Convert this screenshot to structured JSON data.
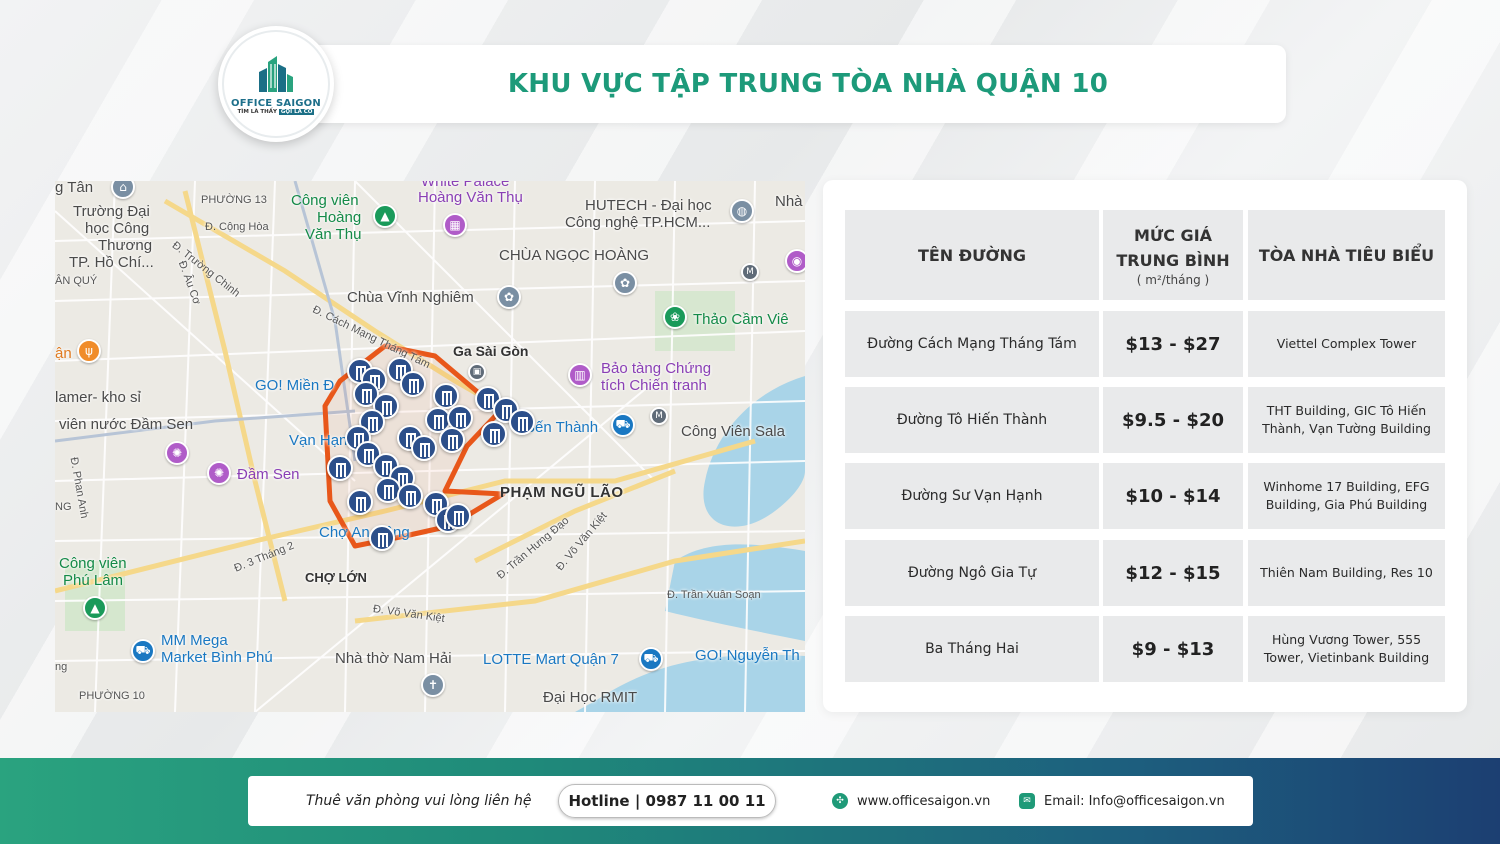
{
  "header": {
    "logo_brand": "OFFICE SAIGON",
    "logo_tagline_a": "TÌM LÀ THẤY",
    "logo_tagline_b": "GỌI LÀ CÓ",
    "title": "KHU VỰC TẬP TRUNG TÒA NHÀ QUẬN 10"
  },
  "map": {
    "labels": {
      "tan": "g Tân",
      "phuong13": "PHƯỜNG 13",
      "truong_dh": "Trường Đại",
      "hoc_cong": "học Công",
      "thuong": "Thương",
      "tphochi": "TP. Hồ Chí...",
      "an_quy": "ÂN QUÝ",
      "d_cong_hoa": "Đ. Cộng Hòa",
      "d_truong_chinh": "Đ. Trường Chinh",
      "d_au_co": "Đ. Âu Cơ",
      "cong_vien": "Công viên",
      "hoang": "Hoàng",
      "van_thu": "Văn Thụ",
      "white_palace": "White Palace",
      "hoang_van_thu": "Hoàng Văn Thụ",
      "hutech": "HUTECH - Đại học",
      "cong_nghe": "Công nghệ TP.HCM...",
      "nha": "Nhà",
      "chua_ngoc_hoang": "CHÙA NGỌC HOÀNG",
      "chua_vinh_nghiem": "Chùa Vĩnh Nghiêm",
      "thao_cam_vien": "Thảo Cầm Viê",
      "d_cmt8": "Đ. Cách Mạng Tháng Tám",
      "an": "ận",
      "ga_sai_gon": "Ga Sài Gòn",
      "go_mien_dong": "GO! Miền Đ",
      "bao_tang": "Bảo tàng Chứng",
      "tich_chien": "tích Chiến tranh",
      "hamer": "lamer- kho sỉ",
      "vien_nuoc": "viên nước Đầm Sen",
      "van_hanh": "Vạn Hạnh",
      "ben_thanh": "Bến Thành",
      "cong_vien_sala": "Công Viên Sala",
      "d_phan_anh": "Đ. Phan Anh",
      "dam_sen": "Đầm Sen",
      "pham_ngu_lao": "PHẠM NGŨ LÃO",
      "ng": "NG",
      "d_3_thang_2": "Đ. 3 Tháng 2",
      "cho_an_dong": "Chợ An Đông",
      "d_tran_hung_dao": "Đ. Trần Hưng Đạo",
      "d_vo_van_kiet": "Đ. Võ Văn Kiệt",
      "cong_vien_phu_lam_a": "Công viên",
      "cong_vien_phu_lam_b": "Phú Lâm",
      "cho_lon": "CHỢ LỚN",
      "d_vo_van_kiet2": "Đ. Võ Văn Kiệt",
      "d_tran_xuan_soan": "Đ. Trần Xuân Soạn",
      "mm_mega": "MM Mega",
      "market_binh_phu": "Market Bình Phú",
      "nha_tho_nam_hai": "Nhà thờ Nam Hải",
      "lotte_mart": "LOTTE Mart Quận 7",
      "go_nguyen": "GO! Nguyễn Th",
      "ng2": "ng",
      "phuong10": "PHƯỜNG 10",
      "dai_hoc_rmit": "Đại Học RMIT"
    },
    "accent_color": "#e8571a",
    "marker_color": "#2c4f8a",
    "marker_icon": "building-icon"
  },
  "table": {
    "headers": {
      "street": "TÊN ĐƯỜNG",
      "price_a": "MỨC GIÁ",
      "price_b": "TRUNG BÌNH",
      "price_unit": "( m²/tháng )",
      "buildings": "TÒA NHÀ TIÊU BIỂU"
    },
    "rows": [
      {
        "street": "Đường Cách Mạng Tháng Tám",
        "price": "$13 - $27",
        "buildings_a": "Viettel Complex Tower",
        "buildings_b": ""
      },
      {
        "street": "Đường Tô Hiến Thành",
        "price": "$9.5 - $20",
        "buildings_a": "THT Building, GIC Tô Hiến",
        "buildings_b": "Thành, Vạn Tường Building"
      },
      {
        "street": "Đường Sư Vạn Hạnh",
        "price": "$10 - $14",
        "buildings_a": "Winhome 17 Building, EFG",
        "buildings_b": "Building, Gia Phú Building"
      },
      {
        "street": "Đường Ngô Gia Tự",
        "price": "$12 - $15",
        "buildings_a": "Thiên Nam Building, Res 10",
        "buildings_b": ""
      },
      {
        "street": "Ba Tháng Hai",
        "price": "$9 - $13",
        "buildings_a": "Hùng Vương Tower, 555",
        "buildings_b": "Tower, Vietinbank Building"
      }
    ]
  },
  "footer": {
    "contact_text": "Thuê văn phòng vui lòng liên hệ",
    "hotline": "Hotline | 0987 11 00 11",
    "website": "www.officesaigon.vn",
    "email": "Email: Info@officesaigon.vn",
    "gradient_start": "#2aa37f",
    "gradient_end": "#1c3f72"
  }
}
